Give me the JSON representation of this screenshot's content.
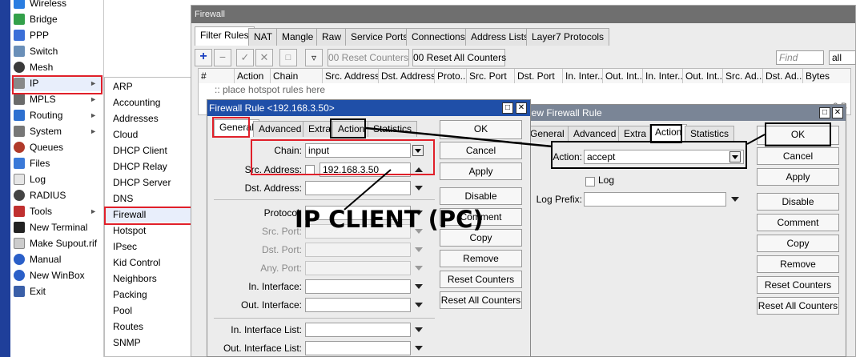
{
  "sidebar": {
    "items": [
      {
        "label": "Wireless",
        "icon": "wireless-icon",
        "color": "#2a7de1"
      },
      {
        "label": "Bridge",
        "icon": "bridge-icon",
        "color": "#33a04a"
      },
      {
        "label": "PPP",
        "icon": "ppp-icon",
        "color": "#3a6fd8"
      },
      {
        "label": "Switch",
        "icon": "switch-icon",
        "color": "#6a8fb8"
      },
      {
        "label": "Mesh",
        "icon": "mesh-icon",
        "color": "#3a3a3a"
      },
      {
        "label": "IP",
        "icon": "ip-icon",
        "color": "#888888"
      },
      {
        "label": "MPLS",
        "icon": "mpls-icon",
        "color": "#6a6a6a"
      },
      {
        "label": "Routing",
        "icon": "routing-icon",
        "color": "#2c6fd0"
      },
      {
        "label": "System",
        "icon": "system-icon",
        "color": "#777777"
      },
      {
        "label": "Queues",
        "icon": "queues-icon",
        "color": "#b03a2a"
      },
      {
        "label": "Files",
        "icon": "files-icon",
        "color": "#3a79d8"
      },
      {
        "label": "Log",
        "icon": "log-icon",
        "color": "#e6e6e6"
      },
      {
        "label": "RADIUS",
        "icon": "radius-icon",
        "color": "#444444"
      },
      {
        "label": "Tools",
        "icon": "tools-icon",
        "color": "#c03030"
      },
      {
        "label": "New Terminal",
        "icon": "terminal-icon",
        "color": "#222222"
      },
      {
        "label": "Make Supout.rif",
        "icon": "supout-icon",
        "color": "#cccccc"
      },
      {
        "label": "Manual",
        "icon": "manual-icon",
        "color": "#2a5fc8"
      },
      {
        "label": "New WinBox",
        "icon": "winbox-icon",
        "color": "#2a5fc8"
      },
      {
        "label": "Exit",
        "icon": "exit-icon",
        "color": "#3a5fa8"
      }
    ]
  },
  "ip_submenu": {
    "items": [
      "ARP",
      "Accounting",
      "Addresses",
      "Cloud",
      "DHCP Client",
      "DHCP Relay",
      "DHCP Server",
      "DNS",
      "Firewall",
      "Hotspot",
      "IPsec",
      "Kid Control",
      "Neighbors",
      "Packing",
      "Pool",
      "Routes",
      "SNMP"
    ]
  },
  "firewall": {
    "title": "Firewall",
    "tabs": [
      "Filter Rules",
      "NAT",
      "Mangle",
      "Raw",
      "Service Ports",
      "Connections",
      "Address Lists",
      "Layer7 Protocols"
    ],
    "toolbar": {
      "reset_counters": "00 Reset Counters",
      "reset_all_counters": "00 Reset All Counters",
      "find_placeholder": "Find",
      "filter_value": "all"
    },
    "columns": [
      "#",
      "Action",
      "Chain",
      "Src. Address",
      "Dst. Address",
      "Proto...",
      "Src. Port",
      "Dst. Port",
      "In. Inter...",
      "Out. Int...",
      "In. Inter...",
      "Out. Int...",
      "Src. Ad...",
      "Dst. Ad...",
      "Bytes"
    ],
    "placeholder_row": ":: place hotspot rules here",
    "bytes_value": "0 B"
  },
  "rule_dialog": {
    "title": "Firewall Rule <192.168.3.50>",
    "tabs": [
      "General",
      "Advanced",
      "Extra",
      "Action",
      "Statistics"
    ],
    "fields": {
      "chain_label": "Chain:",
      "chain_value": "input",
      "src_label": "Src. Address:",
      "src_value": "192.168.3.50",
      "dst_label": "Dst. Address:",
      "protocol_label": "Protocol:",
      "src_port_label": "Src. Port:",
      "dst_port_label": "Dst. Port:",
      "any_port_label": "Any. Port:",
      "in_iface_label": "In. Interface:",
      "out_iface_label": "Out. Interface:",
      "in_iface_list_label": "In. Interface List:",
      "out_iface_list_label": "Out. Interface List:"
    },
    "buttons": [
      "OK",
      "Cancel",
      "Apply",
      "Disable",
      "Comment",
      "Copy",
      "Remove",
      "Reset Counters",
      "Reset All Counters"
    ]
  },
  "new_rule_dialog": {
    "title": "New Firewall Rule",
    "tabs": [
      "General",
      "Advanced",
      "Extra",
      "Action",
      "Statistics"
    ],
    "action_label": "Action:",
    "action_value": "accept",
    "log_label": "Log",
    "log_prefix_label": "Log Prefix:",
    "buttons": [
      "OK",
      "Cancel",
      "Apply",
      "Disable",
      "Comment",
      "Copy",
      "Remove",
      "Reset Counters",
      "Reset All Counters"
    ]
  },
  "annotation": {
    "text": "IP CLIENT (PC)",
    "highlight_color": "#e0202a"
  }
}
